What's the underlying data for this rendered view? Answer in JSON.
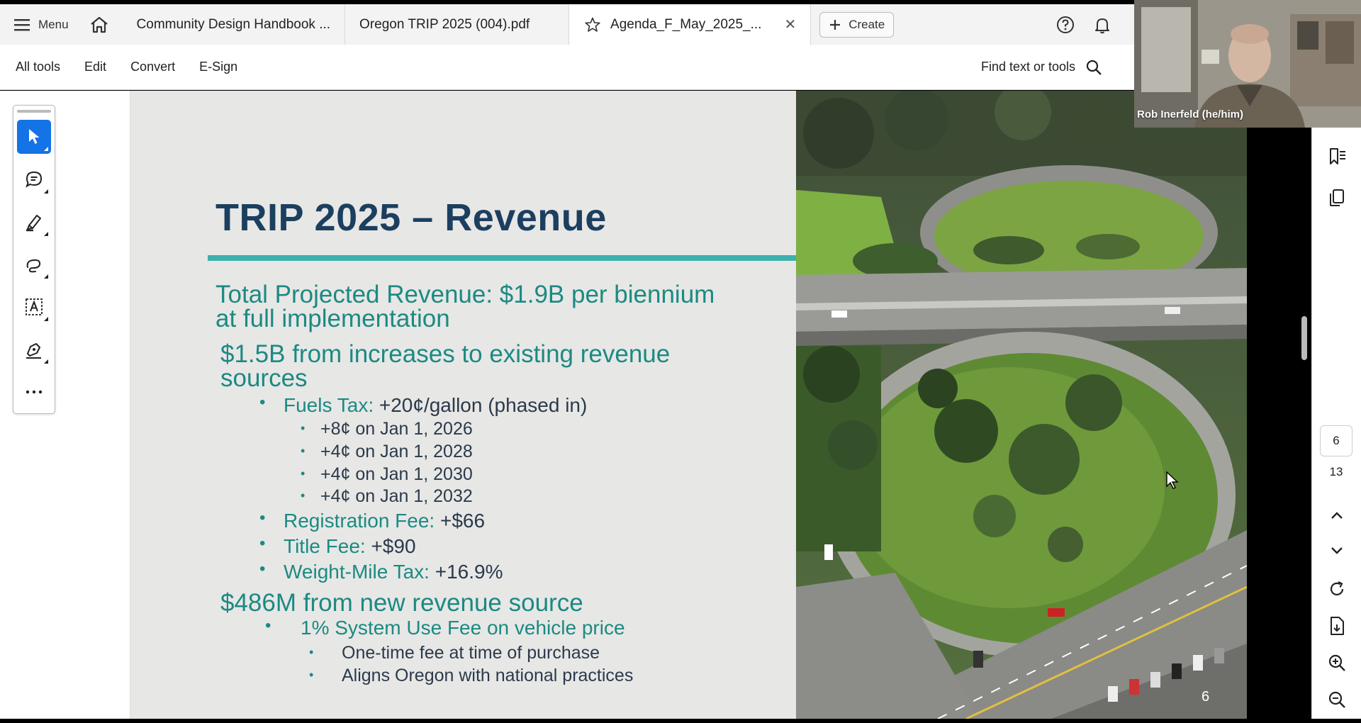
{
  "tabbar": {
    "menu_label": "Menu",
    "tabs": [
      {
        "label": "Community Design Handbook ..."
      },
      {
        "label": "Oregon TRIP 2025 (004).pdf"
      },
      {
        "label": "Agenda_F_May_2025_..."
      }
    ],
    "create_label": "Create"
  },
  "toolbar": {
    "all_tools": "All tools",
    "edit": "Edit",
    "convert": "Convert",
    "esign": "E-Sign",
    "find_label": "Find text or tools"
  },
  "slide": {
    "title": "TRIP 2025 – Revenue",
    "heading_line1": "Total Projected Revenue: $1.9B per biennium",
    "heading_line2": "at full implementation",
    "existing_line1": "$1.5B from increases to existing revenue",
    "existing_line2": "sources",
    "fuels_label": "Fuels Tax:",
    "fuels_value": " +20¢/gallon (phased in)",
    "fuels_steps": [
      "+8¢ on Jan 1, 2026",
      "+4¢ on Jan 1, 2028",
      "+4¢ on Jan 1, 2030",
      "+4¢ on Jan 1, 2032"
    ],
    "registration_label": "Registration Fee:",
    "registration_value": " +$66",
    "title_label": "Title Fee:",
    "title_value": " +$90",
    "weight_label": "Weight-Mile Tax:",
    "weight_value": " +16.9%",
    "new_source": "$486M from new revenue source",
    "use_fee": "1% System Use Fee on vehicle price",
    "use_fee_points": [
      "One-time fee at time of purchase",
      "Aligns Oregon with national practices"
    ],
    "slide_number": "6"
  },
  "rightrail": {
    "current_page": "6",
    "total_pages": "13"
  },
  "webcam": {
    "name": "Rob Inerfeld (he/him)"
  },
  "colors": {
    "accent_blue": "#1473e6",
    "title_navy": "#1c3f5f",
    "teal": "#1b8a82",
    "rule_teal": "#3eb0ac"
  }
}
